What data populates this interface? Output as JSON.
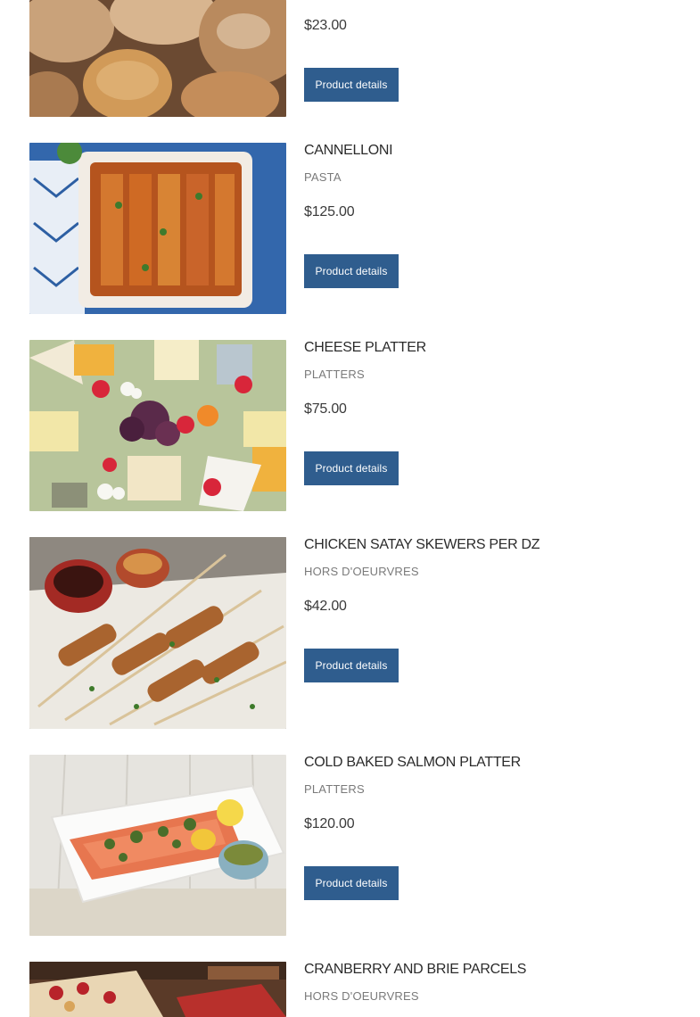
{
  "products": [
    {
      "name": "",
      "category": "",
      "price": "$23.00",
      "button_label": "Product details",
      "image": "bread-photo"
    },
    {
      "name": "CANNELLONI",
      "category": "PASTA",
      "price": "$125.00",
      "button_label": "Product details",
      "image": "cannelloni-photo"
    },
    {
      "name": "CHEESE PLATTER",
      "category": "PLATTERS",
      "price": "$75.00",
      "button_label": "Product details",
      "image": "cheese-platter-photo"
    },
    {
      "name": "CHICKEN SATAY SKEWERS PER DZ",
      "category": "HORS D'OEURVRES",
      "price": "$42.00",
      "button_label": "Product details",
      "image": "satay-skewers-photo"
    },
    {
      "name": "COLD BAKED SALMON PLATTER",
      "category": "PLATTERS",
      "price": "$120.00",
      "button_label": "Product details",
      "image": "salmon-platter-photo"
    },
    {
      "name": "CRANBERRY AND BRIE PARCELS",
      "category": "HORS D'OEURVRES",
      "price": "",
      "button_label": "",
      "image": "cranberry-brie-photo"
    }
  ]
}
